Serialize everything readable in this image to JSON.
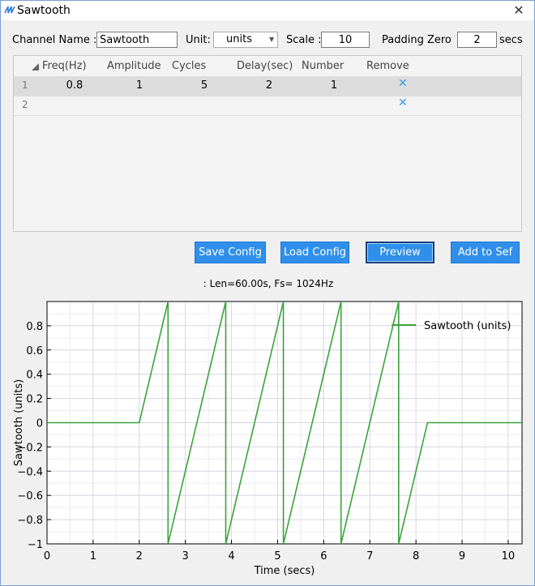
{
  "window": {
    "title": "Sawtooth"
  },
  "form": {
    "channel_label": "Channel Name :",
    "channel_value": "Sawtooth",
    "unit_label": "Unit:",
    "unit_value": "units",
    "scale_label": "Scale :",
    "scale_value": "10",
    "padding_label": "Padding Zero",
    "padding_value": "2",
    "padding_unit": "secs"
  },
  "table": {
    "headers": [
      "Freq(Hz)",
      "Amplitude",
      "Cycles",
      "Delay(sec)",
      "Number",
      "Remove"
    ],
    "rows": [
      {
        "num": "1",
        "freq": "0.8",
        "amp": "1",
        "cycles": "5",
        "delay": "2",
        "number": "1",
        "remove": "✕"
      },
      {
        "num": "2",
        "freq": "",
        "amp": "",
        "cycles": "",
        "delay": "",
        "number": "",
        "remove": "✕"
      }
    ]
  },
  "buttons": {
    "save": "Save Config",
    "load": "Load Config",
    "preview": "Preview",
    "add": "Add to Sef"
  },
  "status": ": Len=60.00s, Fs= 1024Hz",
  "colors": {
    "accent": "#2f8fea",
    "series": "#3aa33a",
    "remove": "#3a9be4"
  },
  "chart_data": {
    "type": "line",
    "xlabel": "Time (secs)",
    "ylabel": "Sawtooth (units)",
    "xlim": [
      0,
      10.3
    ],
    "ylim": [
      -1,
      1
    ],
    "xticks": [
      0,
      1,
      2,
      3,
      4,
      5,
      6,
      7,
      8,
      9,
      10
    ],
    "yticks": [
      -1,
      -0.8,
      -0.6,
      -0.4,
      -0.2,
      0,
      0.2,
      0.4,
      0.6,
      0.8
    ],
    "ytick_labels": [
      "−1",
      "−0.8",
      "−0.6",
      "−0.4",
      "−0.2",
      "0",
      "0.2",
      "0.4",
      "0.6",
      "0.8"
    ],
    "grid": true,
    "legend_position": "top-right",
    "series": [
      {
        "name": "Sawtooth (units)",
        "x": [
          0,
          2,
          2.625,
          2.625,
          3.875,
          3.875,
          5.125,
          5.125,
          6.375,
          6.375,
          7.625,
          7.625,
          8.25,
          10.3
        ],
        "y": [
          0,
          0,
          1,
          -1,
          1,
          -1,
          1,
          -1,
          1,
          -1,
          1,
          -1,
          0,
          0
        ]
      }
    ]
  }
}
